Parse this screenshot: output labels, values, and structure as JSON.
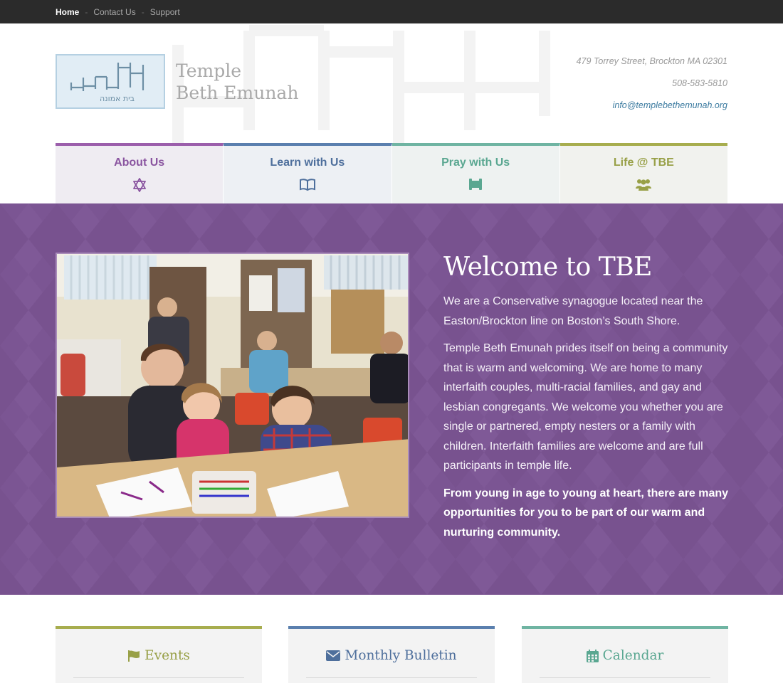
{
  "topnav": {
    "items": [
      {
        "label": "Home",
        "active": true
      },
      {
        "label": "Contact Us",
        "active": false
      },
      {
        "label": "Support",
        "active": false
      }
    ],
    "separator": "-"
  },
  "header": {
    "site_name_line1": "Temple",
    "site_name_line2": "Beth Emunah",
    "logo_hebrew": "בית אמונה",
    "address": "479 Torrey Street, Brockton MA 02301",
    "phone": "508-583-5810",
    "email": "info@templebethemunah.org"
  },
  "mainnav": [
    {
      "label": "About Us",
      "icon": "star-of-david-icon",
      "color": "#8a55a0"
    },
    {
      "label": "Learn with Us",
      "icon": "open-book-icon",
      "color": "#4e6f9c"
    },
    {
      "label": "Pray with Us",
      "icon": "torah-scroll-icon",
      "color": "#5aa791"
    },
    {
      "label": "Life @ TBE",
      "icon": "group-icon",
      "color": "#98a047"
    }
  ],
  "hero": {
    "background_color": "#7b5593",
    "title": "Welcome to TBE",
    "paragraphs": [
      "We are a Conservative synagogue located near the Easton/Brockton line on Boston’s South Shore.",
      "Temple Beth Emunah prides itself on being a community that is warm and welcoming. We are home to many interfaith couples, multi-racial families, and gay and lesbian congregants.  We welcome you whether you are single or partnered, empty nesters or a family with children. Interfaith families are welcome and are full participants in temple life.",
      "From young in age to young at heart, there are many opportunities for you to be part of our  warm and nurturing community."
    ]
  },
  "widgets": [
    {
      "title": "Events",
      "icon": "flag-icon",
      "color": "#98a047"
    },
    {
      "title": "Monthly Bulletin",
      "icon": "envelope-icon",
      "color": "#4e6f9c"
    },
    {
      "title": "Calendar",
      "icon": "calendar-icon",
      "color": "#5aa791"
    }
  ]
}
